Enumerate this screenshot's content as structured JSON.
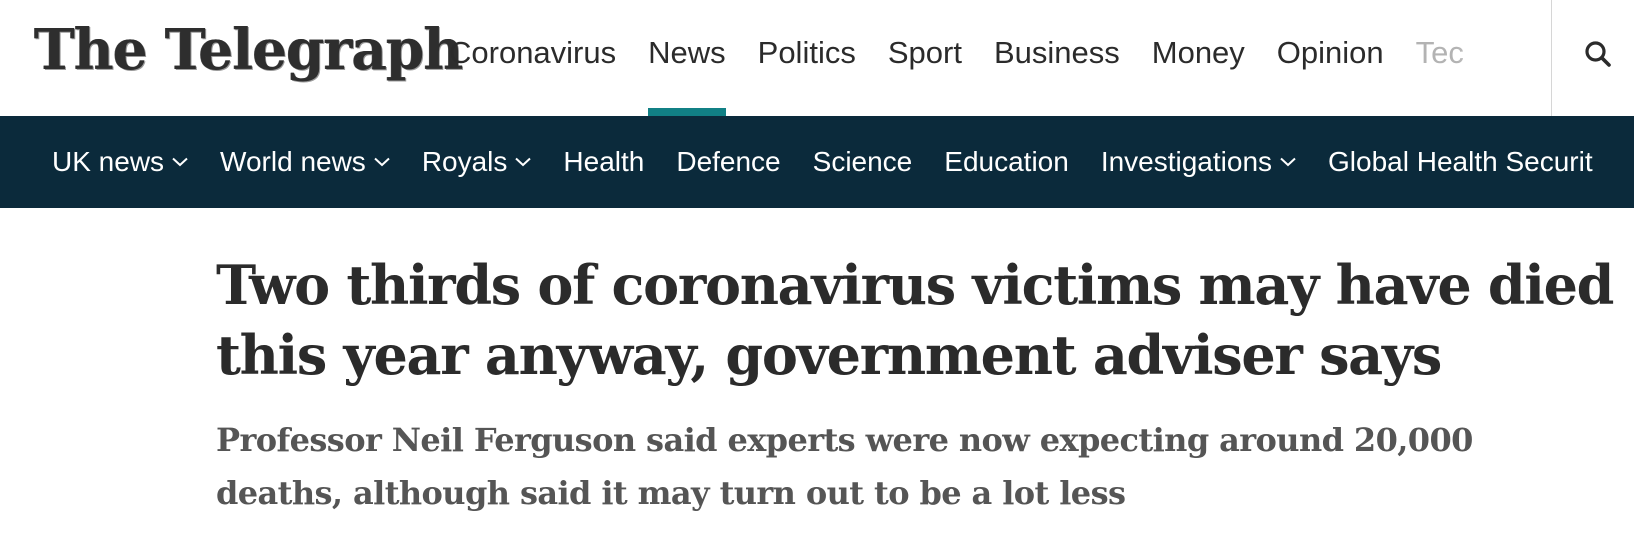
{
  "header": {
    "logo_text": "The Telegraph",
    "primary_nav": [
      {
        "label": "Coronavirus",
        "active": false
      },
      {
        "label": "News",
        "active": true
      },
      {
        "label": "Politics",
        "active": false
      },
      {
        "label": "Sport",
        "active": false
      },
      {
        "label": "Business",
        "active": false
      },
      {
        "label": "Money",
        "active": false
      },
      {
        "label": "Opinion",
        "active": false
      },
      {
        "label": "Tec",
        "active": false
      }
    ],
    "search_icon": "search-icon"
  },
  "secondary_nav": [
    {
      "label": "UK news",
      "has_dropdown": true
    },
    {
      "label": "World news",
      "has_dropdown": true
    },
    {
      "label": "Royals",
      "has_dropdown": true
    },
    {
      "label": "Health",
      "has_dropdown": false
    },
    {
      "label": "Defence",
      "has_dropdown": false
    },
    {
      "label": "Science",
      "has_dropdown": false
    },
    {
      "label": "Education",
      "has_dropdown": false
    },
    {
      "label": "Investigations",
      "has_dropdown": true
    },
    {
      "label": "Global Health Securit",
      "has_dropdown": false
    }
  ],
  "article": {
    "headline": "Two thirds of coronavirus victims may have died this year anyway, government adviser says",
    "subheadline": "Professor Neil Ferguson said experts were now expecting around 20,000 deaths, although said it may turn out to be a lot less"
  },
  "colors": {
    "accent": "#118085",
    "secondary_nav_bg": "#0b2a3b",
    "text": "#2b2b2b"
  }
}
